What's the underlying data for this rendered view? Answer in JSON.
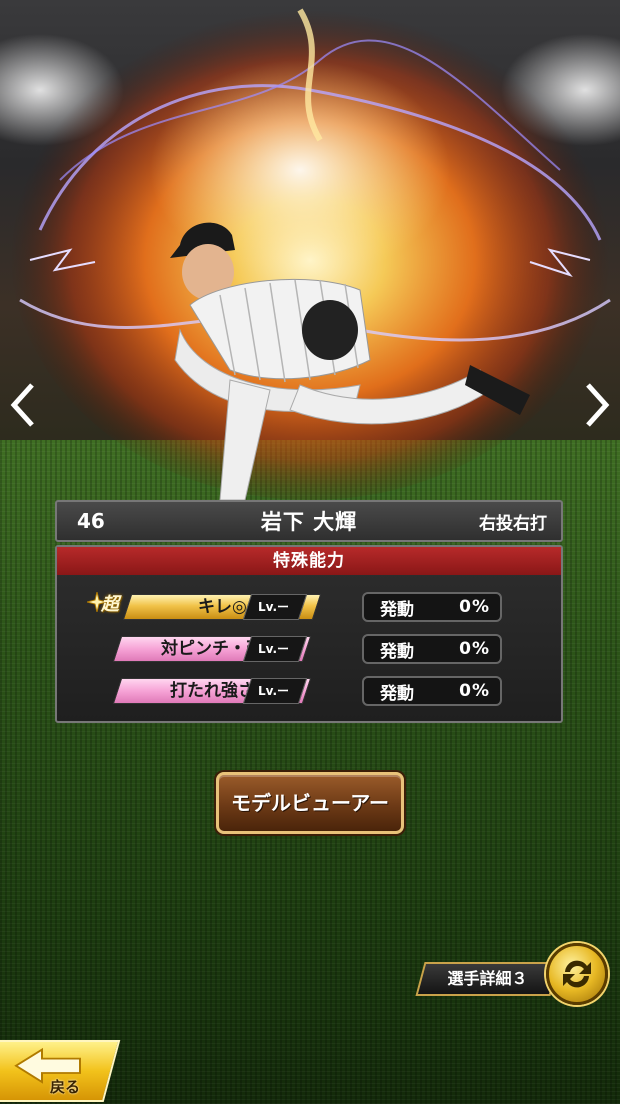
{
  "player": {
    "number": "46",
    "name": "岩下 大輝",
    "throw_bat": "右投右打"
  },
  "abilities": {
    "header": "特殊能力",
    "prefix_super": "超",
    "lv_text": "Lv.ー",
    "items": [
      {
        "label": "キレ◎",
        "style": "gold",
        "super": true,
        "status": "発動",
        "percent": "0%"
      },
      {
        "label": "対ピンチ・改",
        "style": "pink",
        "super": false,
        "status": "発動",
        "percent": "0%"
      },
      {
        "label": "打たれ強さ",
        "style": "pink",
        "super": false,
        "status": "発動",
        "percent": "0%"
      }
    ]
  },
  "buttons": {
    "model_viewer": "モデルビューアー",
    "player_detail": "選手詳細３",
    "back": "戻る"
  },
  "icons": {
    "left_nav": "chevron-left-icon",
    "right_nav": "chevron-right-icon",
    "swap": "swap-arrows-icon",
    "back": "back-arrow-icon"
  },
  "colors": {
    "header_red": "#b72a2a",
    "gold": "#f1c349",
    "pink": "#f6a3d6",
    "button_brown": "#6d3a16"
  }
}
